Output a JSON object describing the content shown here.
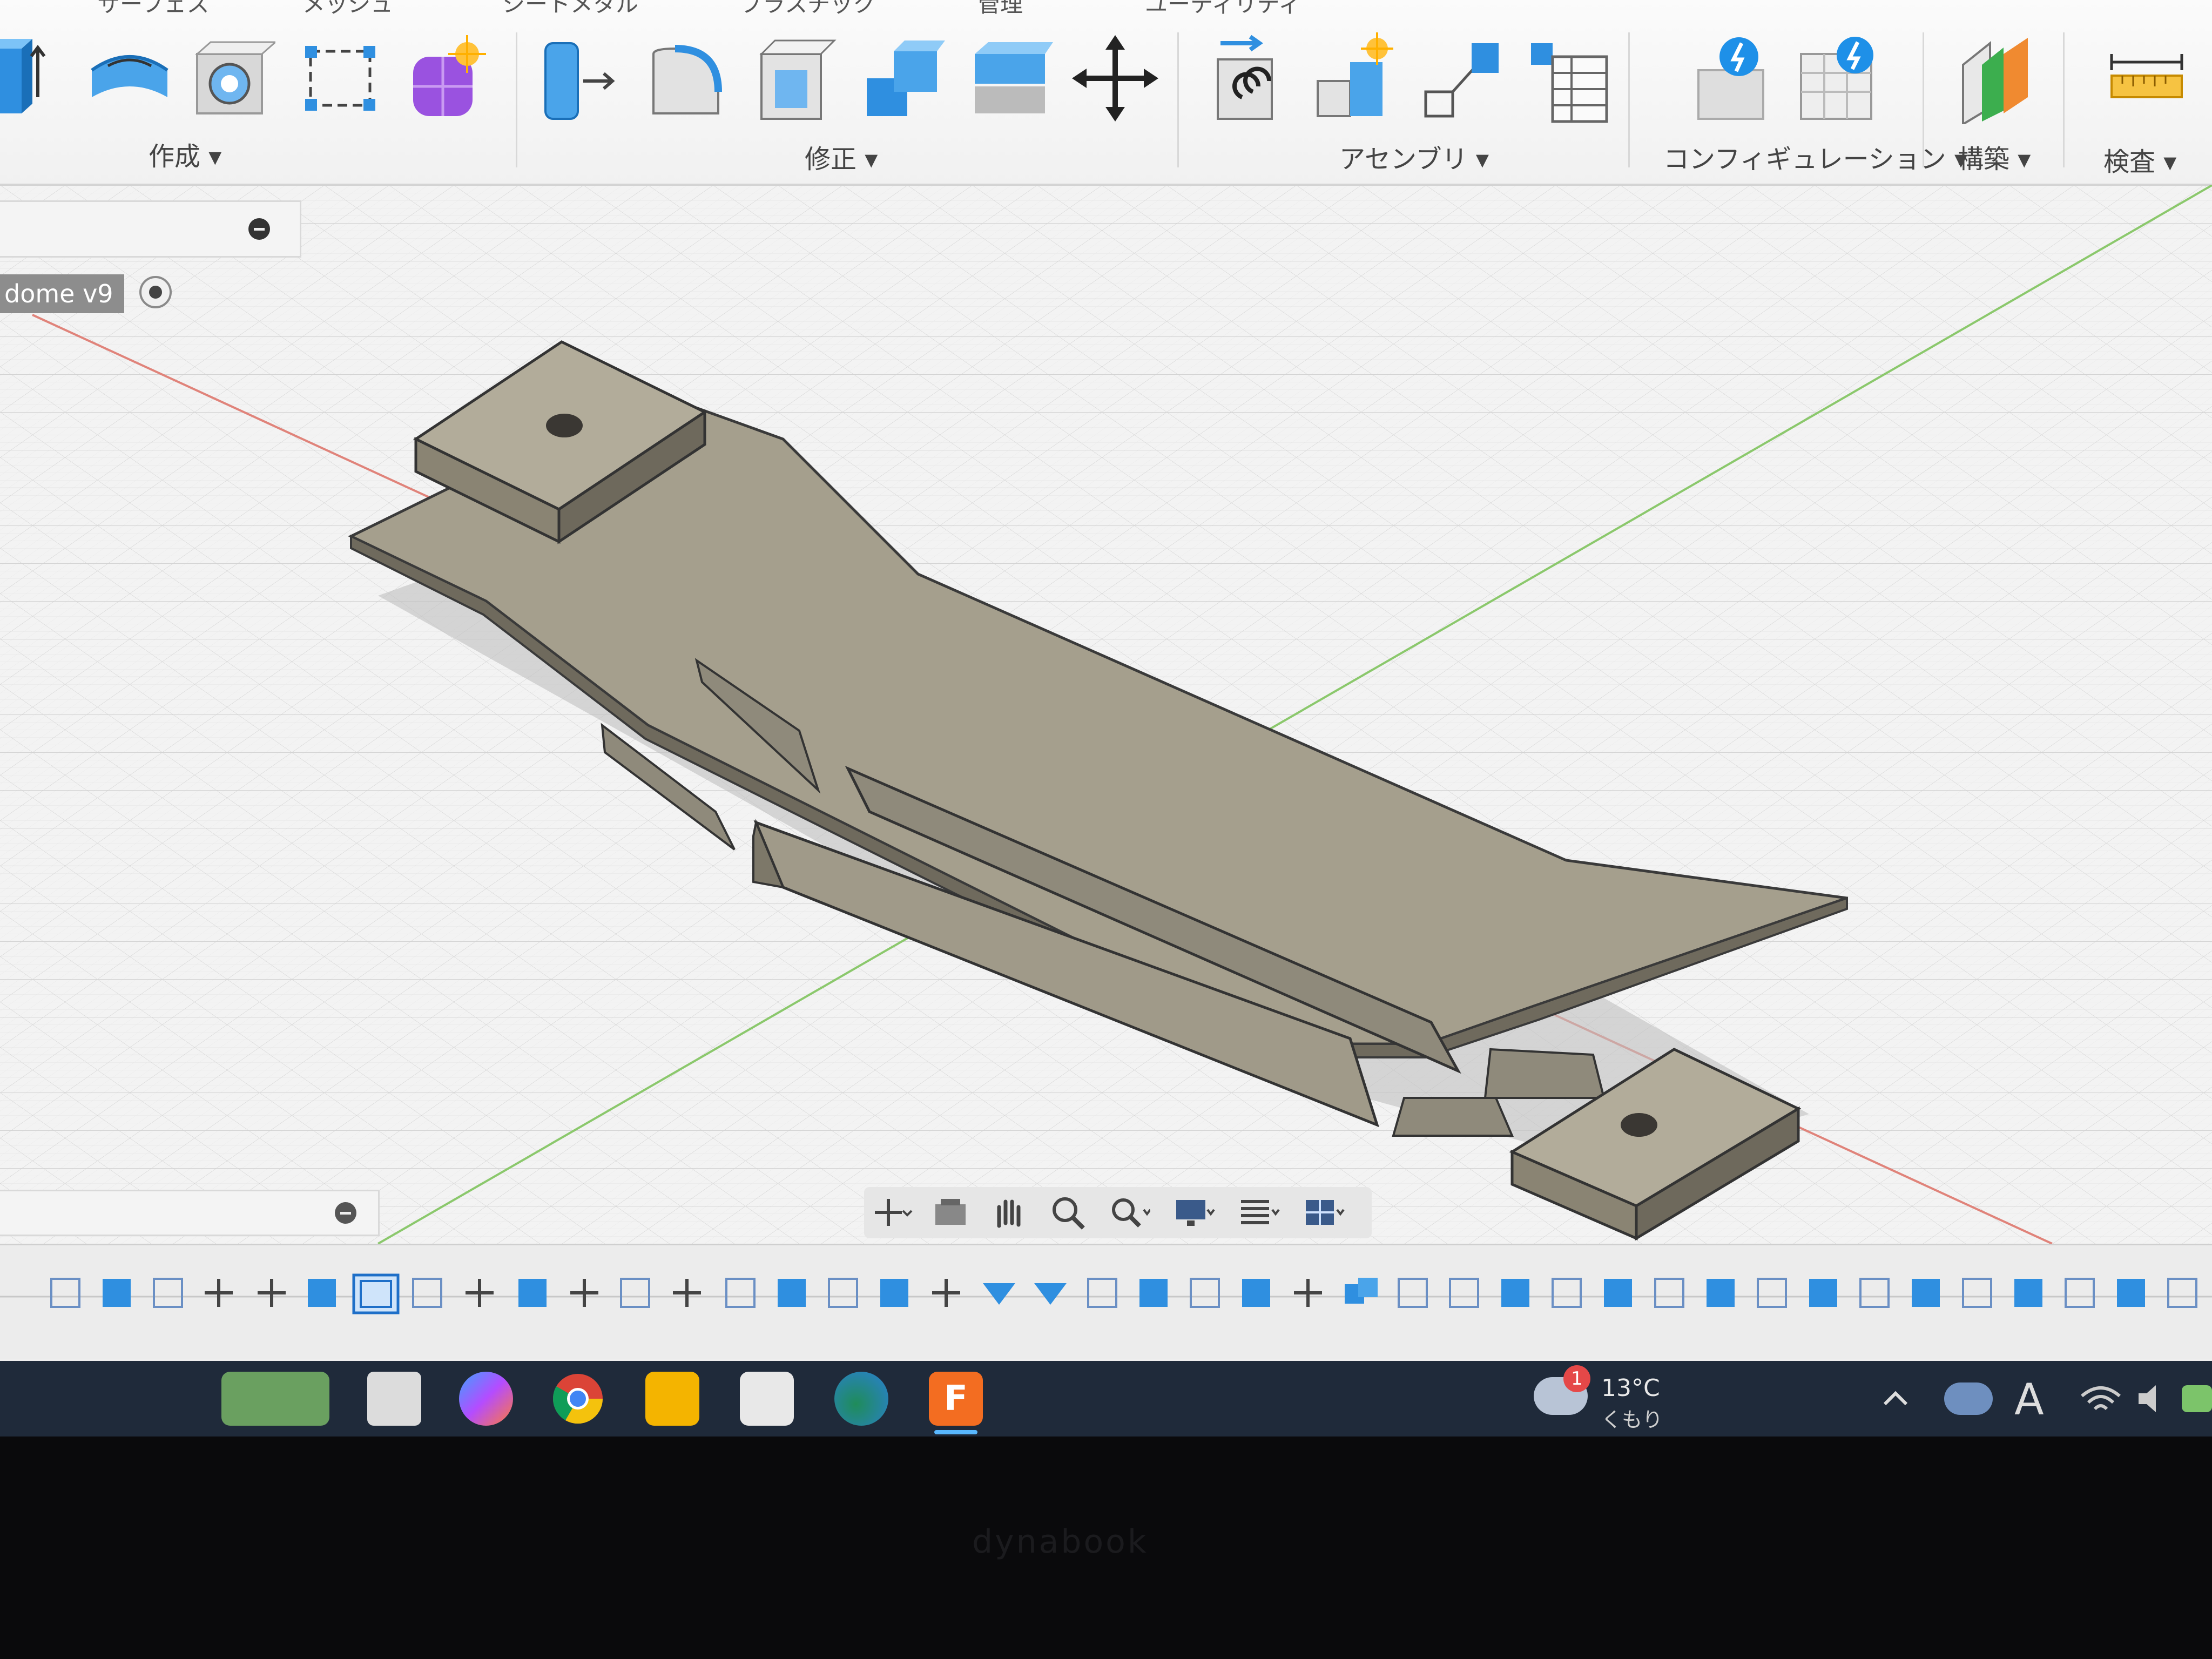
{
  "ribbon": {
    "tabs": [
      "サーフェス",
      "メッシュ",
      "シートメタル",
      "プラスチック",
      "管理",
      "ユーティリティ"
    ],
    "groups": {
      "create": "作成 ▾",
      "modify": "修正 ▾",
      "assemble": "アセンブリ ▾",
      "configure": "コンフィギュレーション ▾",
      "construct": "構築 ▾",
      "inspect": "検査 ▾"
    }
  },
  "browser": {
    "document_name": "dome v9"
  },
  "taskbar": {
    "weather_temp": "13°C",
    "weather_desc": "くもり",
    "notification_count": "1",
    "fusion_label": "F"
  },
  "bezel": {
    "brand": "dynabook"
  },
  "colors": {
    "model_top": "#a29b8a",
    "model_side": "#8a8474",
    "grid_line": "#cfcfcf",
    "axis_red": "#d9776f",
    "axis_green": "#86c46a",
    "accent_blue": "#1e90e8"
  }
}
